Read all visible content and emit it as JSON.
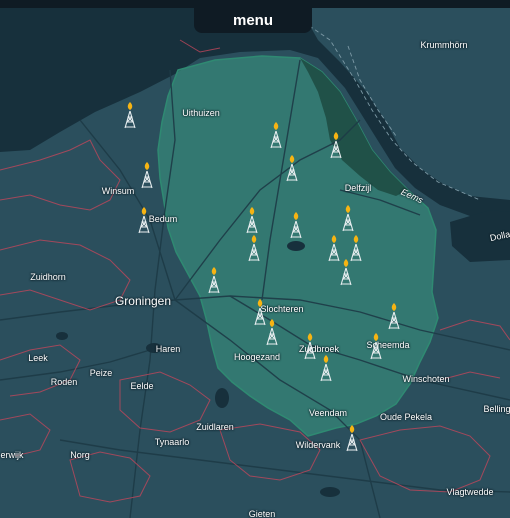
{
  "menu": {
    "label": "menu"
  },
  "colors": {
    "land": "#2b4f5d",
    "water": "#17303c",
    "region_fill": "#3a9a82",
    "region_border": "#c0475b",
    "marker": "#f6b413"
  },
  "places": [
    {
      "id": "krummhorn",
      "label": "Krummhörn",
      "size": "small",
      "kind": "town"
    },
    {
      "id": "uithuizen",
      "label": "Uithuizen",
      "size": "small",
      "kind": "town"
    },
    {
      "id": "winsum",
      "label": "Winsum",
      "size": "small",
      "kind": "town"
    },
    {
      "id": "delfzijl",
      "label": "Delfzijl",
      "size": "small",
      "kind": "town"
    },
    {
      "id": "eems",
      "label": "Eems",
      "size": "small",
      "kind": "water"
    },
    {
      "id": "dollard",
      "label": "Dolla",
      "size": "small",
      "kind": "water"
    },
    {
      "id": "bedum",
      "label": "Bedum",
      "size": "small",
      "kind": "town"
    },
    {
      "id": "zuidhorn",
      "label": "Zuidhorn",
      "size": "small",
      "kind": "town"
    },
    {
      "id": "groningen",
      "label": "Groningen",
      "size": "big",
      "kind": "town"
    },
    {
      "id": "slochteren",
      "label": "Slochteren",
      "size": "small",
      "kind": "town"
    },
    {
      "id": "haren",
      "label": "Haren",
      "size": "small",
      "kind": "town"
    },
    {
      "id": "leek",
      "label": "Leek",
      "size": "small",
      "kind": "town"
    },
    {
      "id": "hoogezand",
      "label": "Hoogezand",
      "size": "small",
      "kind": "town"
    },
    {
      "id": "zuidbroek",
      "label": "Zuidbroek",
      "size": "small",
      "kind": "town"
    },
    {
      "id": "scheemda",
      "label": "Scheemda",
      "size": "small",
      "kind": "town"
    },
    {
      "id": "roden",
      "label": "Roden",
      "size": "small",
      "kind": "town"
    },
    {
      "id": "peize",
      "label": "Peize",
      "size": "small",
      "kind": "town"
    },
    {
      "id": "eelde",
      "label": "Eelde",
      "size": "small",
      "kind": "town"
    },
    {
      "id": "winschoten",
      "label": "Winschoten",
      "size": "small",
      "kind": "town"
    },
    {
      "id": "veendam",
      "label": "Veendam",
      "size": "small",
      "kind": "town"
    },
    {
      "id": "oude-pekela",
      "label": "Oude Pekela",
      "size": "small",
      "kind": "town"
    },
    {
      "id": "bellingwolde",
      "label": "Belling",
      "size": "small",
      "kind": "town"
    },
    {
      "id": "tynaarlo",
      "label": "Tynaarlo",
      "size": "small",
      "kind": "town"
    },
    {
      "id": "zuidlaren",
      "label": "Zuidlaren",
      "size": "small",
      "kind": "town"
    },
    {
      "id": "wildervank",
      "label": "Wildervank",
      "size": "small",
      "kind": "town"
    },
    {
      "id": "norg",
      "label": "Norg",
      "size": "small",
      "kind": "town"
    },
    {
      "id": "vlagtwedde",
      "label": "Vlagtwedde",
      "size": "small",
      "kind": "town"
    },
    {
      "id": "gieten",
      "label": "Gieten",
      "size": "small",
      "kind": "town"
    },
    {
      "id": "erwijk",
      "label": "erwijk",
      "size": "small",
      "kind": "town"
    }
  ],
  "markers": {
    "icon": "gas-tower-icon",
    "count": 24
  }
}
